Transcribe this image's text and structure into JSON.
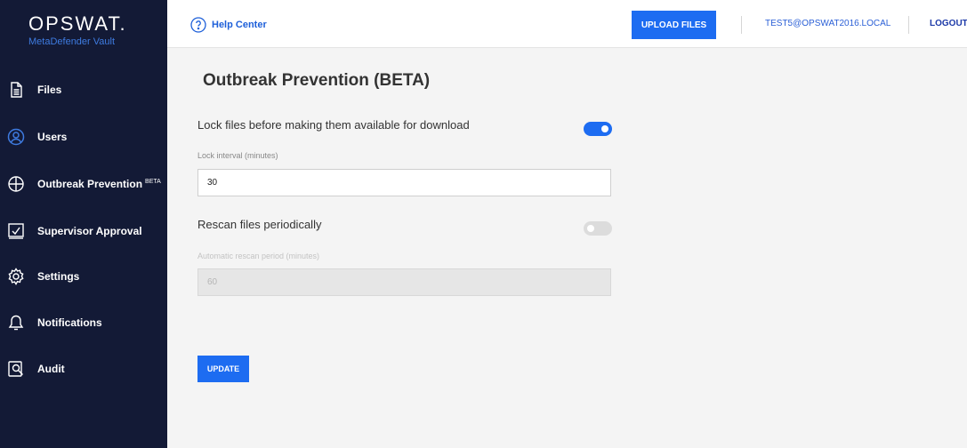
{
  "brand": {
    "logo": "OPSWAT.",
    "product": "MetaDefender Vault"
  },
  "sidebar": {
    "items": [
      {
        "label": "Files",
        "icon": "file-icon",
        "active": false
      },
      {
        "label": "Users",
        "icon": "users-icon",
        "active": true
      },
      {
        "label": "Outbreak Prevention",
        "badge": "BETA",
        "icon": "shield-icon",
        "active": false
      },
      {
        "label": "Supervisor Approval",
        "icon": "approval-icon",
        "active": false
      },
      {
        "label": "Settings",
        "icon": "gear-icon",
        "active": false
      },
      {
        "label": "Notifications",
        "icon": "bell-icon",
        "active": false
      },
      {
        "label": "Audit",
        "icon": "audit-icon",
        "active": false
      }
    ]
  },
  "topbar": {
    "help_label": "Help Center",
    "upload_label": "UPLOAD FILES",
    "user_email": "TEST5@OPSWAT2016.LOCAL",
    "logout_label": "LOGOUT"
  },
  "main": {
    "title": "Outbreak Prevention (BETA)",
    "lock": {
      "label": "Lock files before making them available for download",
      "enabled": true,
      "interval_label": "Lock interval (minutes)",
      "interval_value": "30"
    },
    "rescan": {
      "label": "Rescan files periodically",
      "enabled": false,
      "period_label": "Automatic rescan period (minutes)",
      "period_value": "60"
    },
    "update_label": "UPDATE"
  },
  "colors": {
    "sidebar_bg": "#131a36",
    "accent": "#1d6cf1",
    "brand_sub": "#3e7be0",
    "page_bg": "#f4f4f4"
  }
}
